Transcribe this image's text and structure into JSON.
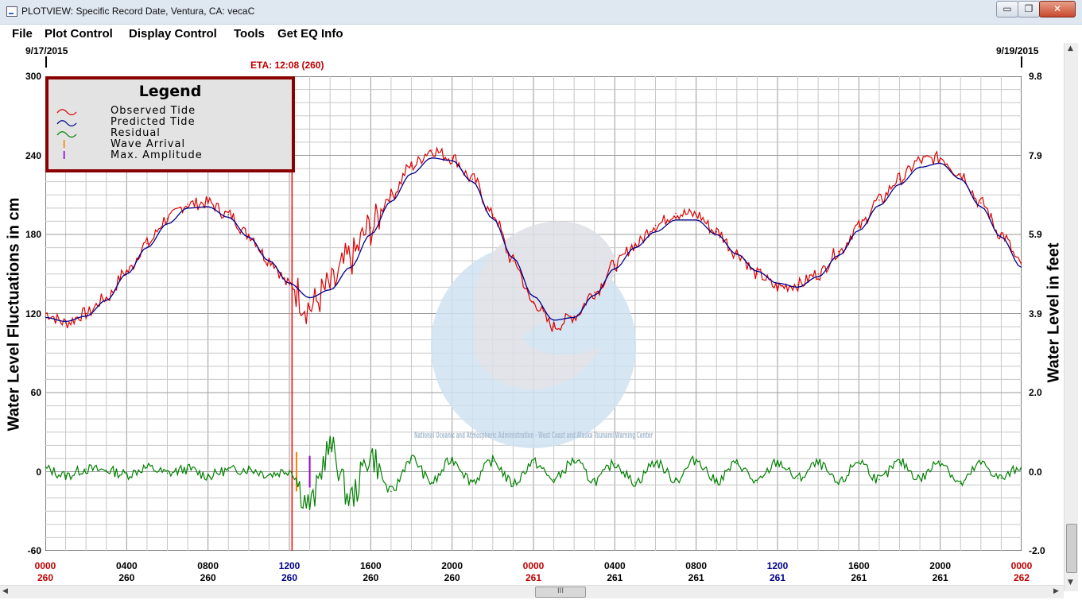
{
  "window": {
    "title": "PLOTVIEW: Specific Record Date, Ventura, CA: vecaC",
    "min_glyph": "▭",
    "max_glyph": "❐",
    "close_glyph": "✕"
  },
  "menu": [
    "File",
    "Plot Control",
    "Display Control",
    "Tools",
    "Get EQ Info"
  ],
  "plot": {
    "start_date": "9/17/2015",
    "end_date": "9/19/2015",
    "eta_label": "ETA: 12:08 (260)",
    "left_axis_title": "Water Level Fluctuations in cm",
    "right_axis_title": "Water Level in feet",
    "left_ticks": [
      "300",
      "240",
      "180",
      "120",
      "60",
      "0",
      "-60"
    ],
    "right_ticks": [
      "9.8",
      "7.9",
      "5.9",
      "3.9",
      "2.0",
      "0.0",
      "-2.0"
    ],
    "x_ticks": [
      {
        "time": "0000",
        "day": "260",
        "color": "#c00000"
      },
      {
        "time": "0400",
        "day": "260",
        "color": "#000000"
      },
      {
        "time": "0800",
        "day": "260",
        "color": "#000000"
      },
      {
        "time": "1200",
        "day": "260",
        "color": "#00008b"
      },
      {
        "time": "1600",
        "day": "260",
        "color": "#000000"
      },
      {
        "time": "2000",
        "day": "260",
        "color": "#000000"
      },
      {
        "time": "0000",
        "day": "261",
        "color": "#c00000"
      },
      {
        "time": "0400",
        "day": "261",
        "color": "#000000"
      },
      {
        "time": "0800",
        "day": "261",
        "color": "#000000"
      },
      {
        "time": "1200",
        "day": "261",
        "color": "#00008b"
      },
      {
        "time": "1600",
        "day": "261",
        "color": "#000000"
      },
      {
        "time": "2000",
        "day": "261",
        "color": "#000000"
      },
      {
        "time": "0000",
        "day": "262",
        "color": "#c00000"
      }
    ]
  },
  "legend": {
    "title": "Legend",
    "items": [
      {
        "label": "Observed Tide",
        "color": "#dd0000",
        "icon": "wave-icon"
      },
      {
        "label": "Predicted Tide",
        "color": "#00008b",
        "icon": "wave-icon"
      },
      {
        "label": "Residual",
        "color": "#008000",
        "icon": "wave-icon"
      },
      {
        "label": "Wave Arrival",
        "color": "#ff8000",
        "icon": "bar-icon"
      },
      {
        "label": "Max. Amplitude",
        "color": "#9900cc",
        "icon": "bar-icon"
      }
    ]
  },
  "watermark": {
    "text": "National Oceanic and Atmospheric Administration · West Coast and Alaska Tsunami Warning Center"
  },
  "scrollbar": {
    "grip": "III",
    "left_arrow": "◀",
    "right_arrow": "▶",
    "up_arrow": "▲",
    "down_arrow": "▼"
  },
  "chart_data": {
    "type": "line",
    "x_unit": "hours since 0000 day 260",
    "xlim": [
      0,
      48
    ],
    "ylim": [
      -60,
      300
    ],
    "y2lim": [
      -2.0,
      9.8
    ],
    "grid": true,
    "legend_position": "top-left",
    "eta_x": 12.13,
    "wave_arrival_x": 12.35,
    "max_amplitude_x": 13.0,
    "series": [
      {
        "name": "Predicted Tide",
        "color": "#00008b",
        "x": [
          0,
          1,
          2,
          3,
          4,
          5,
          6,
          7,
          8,
          9,
          10,
          11,
          12,
          13,
          14,
          15,
          16,
          17,
          18,
          19,
          20,
          21,
          22,
          23,
          24,
          25,
          26,
          27,
          28,
          29,
          30,
          31,
          32,
          33,
          34,
          35,
          36,
          37,
          38,
          39,
          40,
          41,
          42,
          43,
          44,
          45,
          46,
          47,
          48
        ],
        "y": [
          117,
          114,
          118,
          130,
          150,
          170,
          188,
          200,
          201,
          193,
          178,
          160,
          143,
          132,
          138,
          155,
          180,
          205,
          226,
          238,
          236,
          220,
          192,
          162,
          133,
          115,
          117,
          134,
          154,
          170,
          182,
          191,
          191,
          180,
          165,
          152,
          143,
          140,
          148,
          164,
          183,
          202,
          218,
          231,
          234,
          222,
          201,
          178,
          155
        ]
      },
      {
        "name": "Observed Tide",
        "color": "#dd0000",
        "x": [
          0,
          1,
          2,
          3,
          4,
          5,
          6,
          7,
          8,
          9,
          10,
          11,
          12,
          13,
          14,
          15,
          16,
          17,
          18,
          19,
          20,
          21,
          22,
          23,
          24,
          25,
          26,
          27,
          28,
          29,
          30,
          31,
          32,
          33,
          34,
          35,
          36,
          37,
          38,
          39,
          40,
          41,
          42,
          43,
          44,
          45,
          46,
          47,
          48
        ],
        "y": [
          120,
          113,
          120,
          132,
          152,
          173,
          192,
          203,
          204,
          195,
          180,
          161,
          142,
          125,
          140,
          162,
          185,
          210,
          232,
          244,
          238,
          222,
          195,
          160,
          128,
          110,
          118,
          136,
          157,
          172,
          187,
          196,
          195,
          182,
          166,
          150,
          140,
          142,
          150,
          167,
          186,
          206,
          222,
          236,
          238,
          226,
          204,
          180,
          157
        ]
      },
      {
        "name": "Residual",
        "color": "#008000",
        "x": [
          0,
          1,
          2,
          3,
          4,
          5,
          6,
          7,
          8,
          9,
          10,
          11,
          12,
          13,
          14,
          15,
          16,
          17,
          18,
          19,
          20,
          21,
          22,
          23,
          24,
          25,
          26,
          27,
          28,
          29,
          30,
          31,
          32,
          33,
          34,
          35,
          36,
          37,
          38,
          39,
          40,
          41,
          42,
          43,
          44,
          45,
          46,
          47,
          48
        ],
        "y": [
          2,
          -3,
          2,
          1,
          -2,
          3,
          -1,
          2,
          -3,
          1,
          2,
          -2,
          1,
          -25,
          18,
          -20,
          12,
          -15,
          10,
          -8,
          9,
          -7,
          8,
          -9,
          7,
          -6,
          8,
          -7,
          6,
          -8,
          7,
          -6,
          9,
          -7,
          6,
          -8,
          7,
          -5,
          6,
          -9,
          8,
          -6,
          7,
          -5,
          8,
          -9,
          6,
          -5,
          4
        ]
      }
    ]
  }
}
